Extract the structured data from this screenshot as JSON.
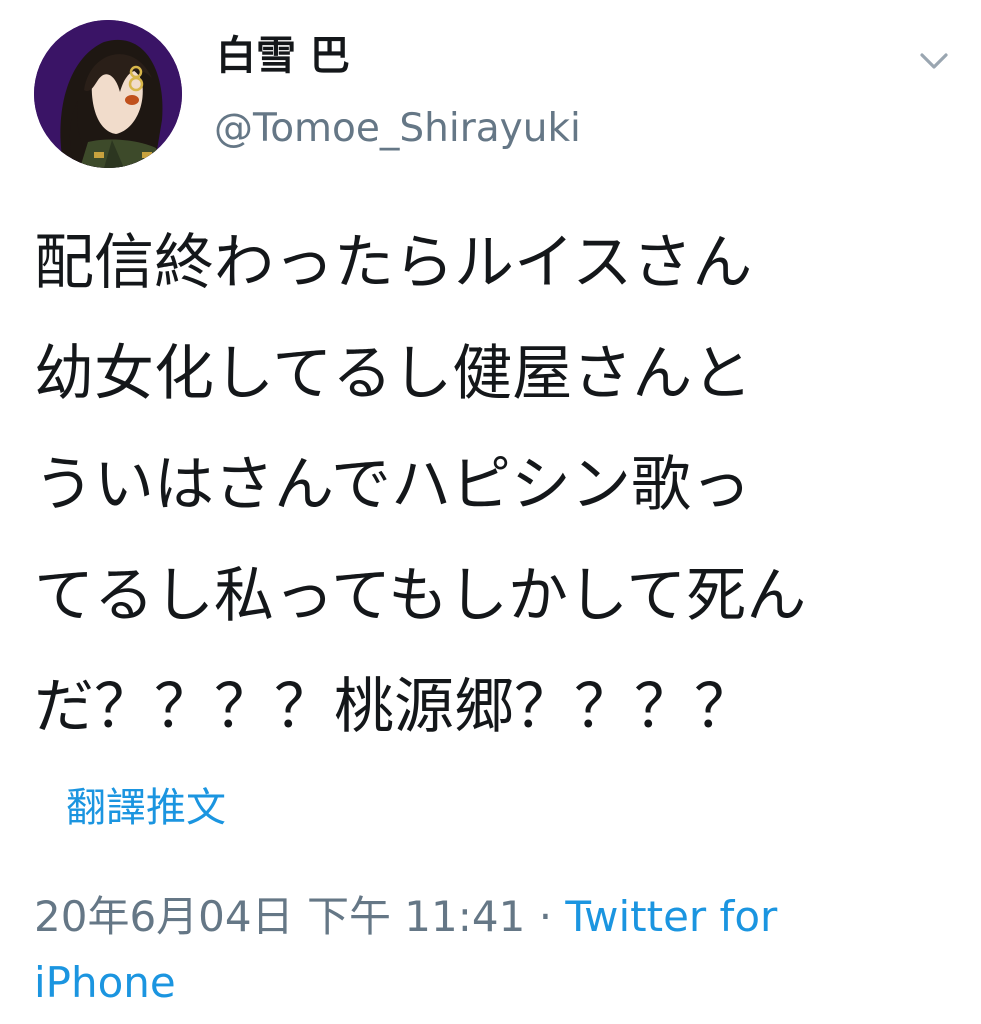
{
  "colors": {
    "text": "#14171a",
    "secondary": "#657786",
    "link": "#1b95e0",
    "background": "#ffffff",
    "avatar_background": "#3a1466"
  },
  "user": {
    "display_name": "白雪 巴",
    "handle": "@Tomoe_Shirayuki",
    "avatar_icon": "user-avatar"
  },
  "caret_icon": "chevron-down-icon",
  "tweet": {
    "lines": [
      "配信終わったらルイスさん",
      "幼女化してるし健屋さんと",
      "ういはさんでハピシン歌っ",
      "てるし私ってもしかして死ん",
      "だ？？？？桃源郷？？？？"
    ]
  },
  "translate_label": "翻譯推文",
  "meta": {
    "timestamp": "20年6月04日 下午 11:41",
    "separator": " · ",
    "source_line1": "Twitter for",
    "source_line2": "iPhone"
  }
}
